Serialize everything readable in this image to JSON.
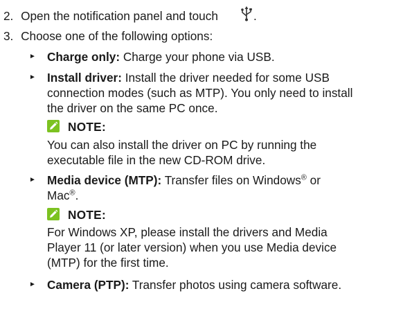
{
  "steps": [
    {
      "number": "2.",
      "text": "Open the notification panel and touch",
      "icon": "usb-icon",
      "after_icon": "."
    },
    {
      "number": "3.",
      "text": "Choose one of the following options:"
    }
  ],
  "options": [
    {
      "bullet": "►",
      "label": "Charge only:",
      "lines": [
        " Charge your phone via USB."
      ]
    },
    {
      "bullet": "►",
      "label": "Install driver:",
      "lines": [
        " Install the driver needed for some USB",
        "connection modes (such as MTP). You only need to install",
        "the driver on the same PC once."
      ],
      "note": {
        "label": "NOTE:",
        "lines": [
          "You can also install the driver on PC by running the",
          "executable file in the new CD-ROM drive."
        ]
      }
    },
    {
      "bullet": "►",
      "label": "Media device (MTP):",
      "lines": [
        " Transfer files on Windows",
        "Mac"
      ],
      "registered": "®",
      "connector": " or",
      "end": ".",
      "note": {
        "label": "NOTE:",
        "lines": [
          "For Windows XP, please install the drivers and Media",
          "Player 11 (or later version) when you use Media device",
          "(MTP) for the first time."
        ]
      }
    },
    {
      "bullet": "►",
      "label": "Camera (PTP):",
      "lines": [
        " Transfer photos using camera software."
      ]
    }
  ],
  "colors": {
    "note_icon": "#7cc221",
    "text": "#1a1a1a"
  }
}
